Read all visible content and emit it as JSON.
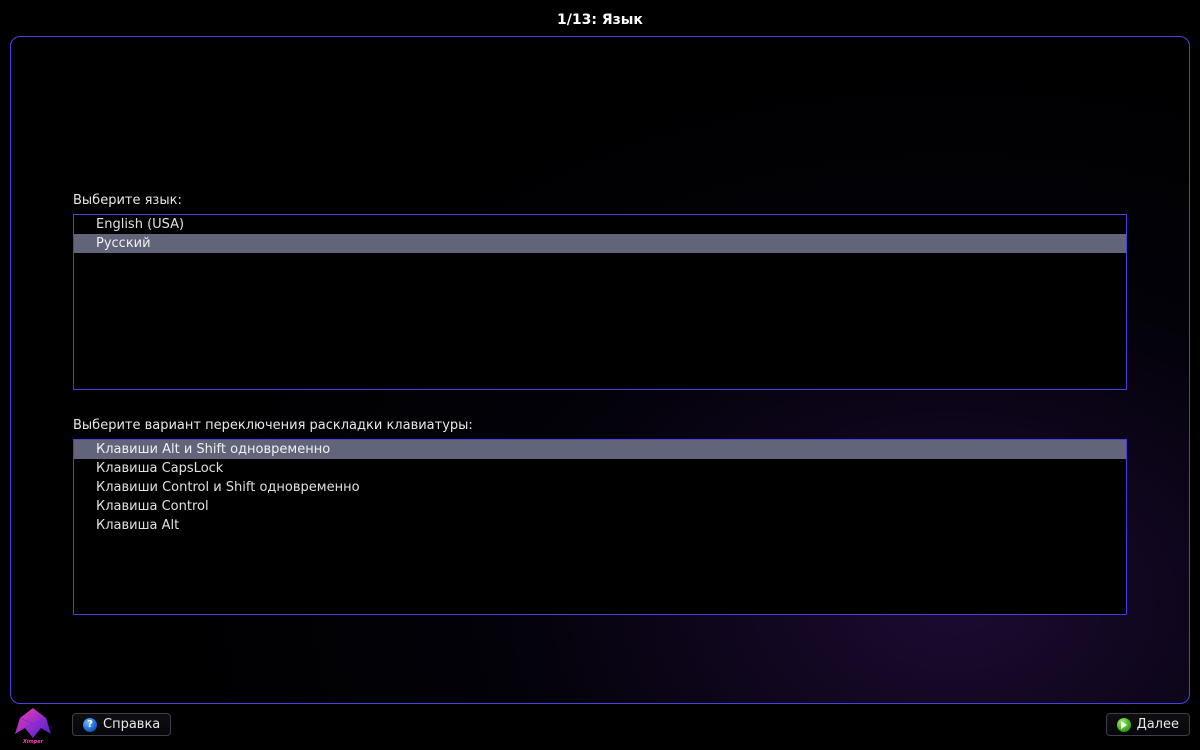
{
  "title": "1/13: Язык",
  "language": {
    "label": "Выберите язык:",
    "items": [
      {
        "label": "English (USA)",
        "selected": false
      },
      {
        "label": "Русский",
        "selected": true
      }
    ]
  },
  "layout_switch": {
    "label": "Выберите вариант переключения раскладки клавиатуры:",
    "items": [
      {
        "label": "Клавиши Alt и Shift одновременно",
        "selected": true
      },
      {
        "label": "Клавиша CapsLock",
        "selected": false
      },
      {
        "label": "Клавиши Control и Shift одновременно",
        "selected": false
      },
      {
        "label": "Клавиша Control",
        "selected": false
      },
      {
        "label": "Клавиша Alt",
        "selected": false
      }
    ]
  },
  "buttons": {
    "help": "Справка",
    "next": "Далее"
  },
  "icons": {
    "help_glyph": "?"
  }
}
